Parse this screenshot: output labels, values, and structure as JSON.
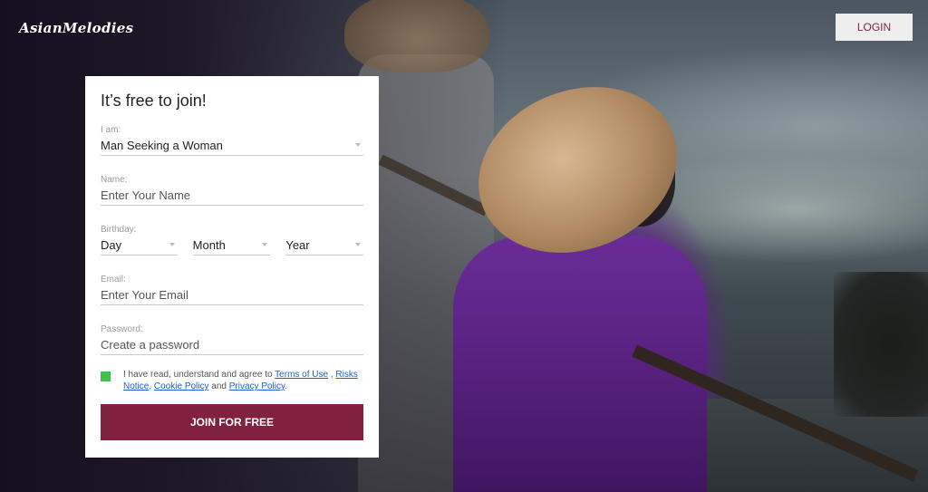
{
  "header": {
    "logo": "AsianMelodies",
    "login_label": "LOGIN"
  },
  "form": {
    "title": "It’s free to join!",
    "iam": {
      "label": "I am:",
      "value": "Man Seeking a Woman"
    },
    "name": {
      "label": "Name:",
      "placeholder": "Enter Your Name"
    },
    "birthday": {
      "label": "Birthday:",
      "day": "Day",
      "month": "Month",
      "year": "Year"
    },
    "email": {
      "label": "Email:",
      "placeholder": "Enter Your Email"
    },
    "password": {
      "label": "Password:",
      "placeholder": "Create a password"
    },
    "agree": {
      "text_before": "I have read, understand and agree to ",
      "terms": "Terms of Use",
      "sep1": " , ",
      "risks": "Risks Notice",
      "sep2": ", ",
      "cookie": "Cookie Policy",
      "sep3": " and ",
      "privacy": "Privacy Policy",
      "end": "."
    },
    "submit_label": "JOIN FOR FREE"
  },
  "colors": {
    "brand": "#80213f",
    "checkbox": "#3cc14a",
    "link": "#1a5fd4"
  }
}
